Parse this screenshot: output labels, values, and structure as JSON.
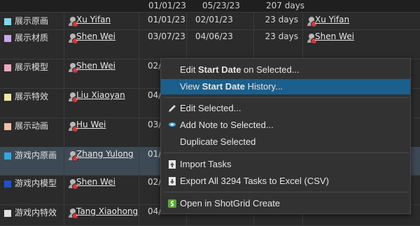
{
  "summary": {
    "start": "01/01/23",
    "due": "05/23/23",
    "duration": "207 days"
  },
  "rows": [
    {
      "name": "展示原画",
      "color": "#7fd8f0",
      "user": "Xu Yifan",
      "start": "01/01/23",
      "due": "02/01/23",
      "duration": "23 days",
      "assignee": "Xu Yifan"
    },
    {
      "name": "展示材质",
      "color": "#c9a8e8",
      "user": "Shen Wei",
      "start": "03/07/23",
      "due": "04/06/23",
      "duration": "23 days",
      "assignee": "Shen Wei"
    },
    {
      "name": "展示模型",
      "color": "#f0a8c0",
      "user": "Shen Wei",
      "start": "02/",
      "due": "",
      "duration": "",
      "assignee": ""
    },
    {
      "name": "展示特效",
      "color": "#f0e8a0",
      "user": "Liu Xiaoyan",
      "start": "04/",
      "due": "",
      "duration": "",
      "assignee": ""
    },
    {
      "name": "展示动画",
      "color": "#f0c0a8",
      "user": "Hu Wei",
      "start": "03/",
      "due": "",
      "duration": "",
      "assignee": ""
    },
    {
      "name": "游戏内原画",
      "color": "#2fa8e0",
      "user": "Zhang Yulong",
      "start": "01/",
      "due": "",
      "duration": "",
      "assignee": ""
    },
    {
      "name": "游戏内模型",
      "color": "#2050d0",
      "user": "Shen Wei",
      "start": "02/",
      "due": "",
      "duration": "",
      "assignee": ""
    },
    {
      "name": "游戏内特效",
      "color": "#e0e0e0",
      "user": "Tang Xiaohong",
      "start": "04/",
      "due": "",
      "duration": "",
      "assignee": ""
    }
  ],
  "menu": {
    "edit_start_prefix": "Edit ",
    "edit_start_bold": "Start Date",
    "edit_start_suffix": " on Selected...",
    "view_history_prefix": "View ",
    "view_history_bold": "Start Date",
    "view_history_suffix": " History...",
    "edit_selected": "Edit Selected...",
    "add_note": "Add Note to Selected...",
    "duplicate": "Duplicate Selected",
    "import_tasks": "Import Tasks",
    "export": "Export All 3294 Tasks to Excel (CSV)",
    "open_create": "Open in ShotGrid Create"
  }
}
